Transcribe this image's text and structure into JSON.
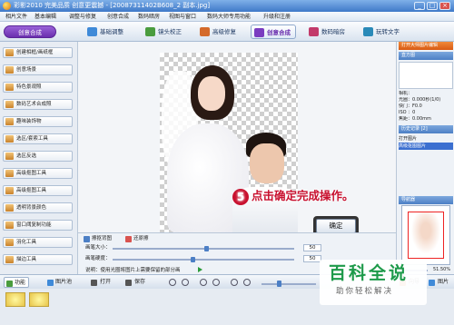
{
  "window": {
    "title": "彩影2010 完美品质 创意更震撼 - [20087311402B608_2 副本.jpg]",
    "controls": [
      "_",
      "□",
      "×"
    ]
  },
  "menu": [
    "相片文件",
    "基本编辑",
    "调整与修复",
    "创意合成",
    "数码暗房",
    "视图与窗口",
    "数码大师专用功能",
    "升级和注册"
  ],
  "toolbar": {
    "mode_button": "创意合成",
    "tabs": [
      {
        "label": "基础调整",
        "icon": "adjust-icon",
        "color": "#3f8ad8"
      },
      {
        "label": "镜头校正",
        "icon": "lens-icon",
        "color": "#4a9c3e"
      },
      {
        "label": "高级修复",
        "icon": "repair-icon",
        "color": "#d46a2a"
      },
      {
        "label": "创意合成",
        "icon": "compose-icon",
        "color": "#7a3cc0",
        "active": true
      },
      {
        "label": "数码暗房",
        "icon": "darkroom-icon",
        "color": "#c23a6a"
      },
      {
        "label": "玩转文字",
        "icon": "text-icon",
        "color": "#2a8ab8"
      }
    ]
  },
  "sidebar": {
    "items": [
      "创建相框/画纸框",
      "创意场景",
      "特色景观照",
      "数码艺术合成照",
      "趣味装饰物",
      "选区/套索工具",
      "选区反选",
      "高级抠图工具",
      "高级抠图工具",
      "透明背景颜色",
      "窗口阈复制功能",
      "羽化工具",
      "描边工具"
    ]
  },
  "callout": {
    "step": "5",
    "text": "点击确定完成操作。"
  },
  "ok_button": "确定",
  "right_panel": {
    "promo": "打开大师图片编辑",
    "histogram_title": "直方图",
    "info": [
      "相机：",
      "光圈：0.000秒(1/0)",
      "快门：F0.0",
      "ISO ：0",
      "焦距：0.00mm"
    ],
    "history_title": "历史记录 [2]",
    "history": [
      "打开图片",
      "高级抠图图片"
    ],
    "navigator_title": "导航器",
    "zoom": "51.50%"
  },
  "options": {
    "mode_buttons": [
      "擦抠背图",
      "还原擦"
    ],
    "sliders": [
      {
        "label": "画笔大小：",
        "value": "50",
        "level": 0.52
      },
      {
        "label": "画笔硬度：",
        "value": "50",
        "level": 0.44
      }
    ],
    "hint": "说明：使用光圈将图片上需要保留的部分画"
  },
  "statusbar": {
    "tabs": [
      "功能",
      "图片池"
    ],
    "buttons": [
      "打开",
      "保存"
    ],
    "right_buttons": [
      "向导",
      "图片"
    ]
  },
  "watermark": {
    "title": "百科全说",
    "subtitle": "助你轻松解决"
  }
}
